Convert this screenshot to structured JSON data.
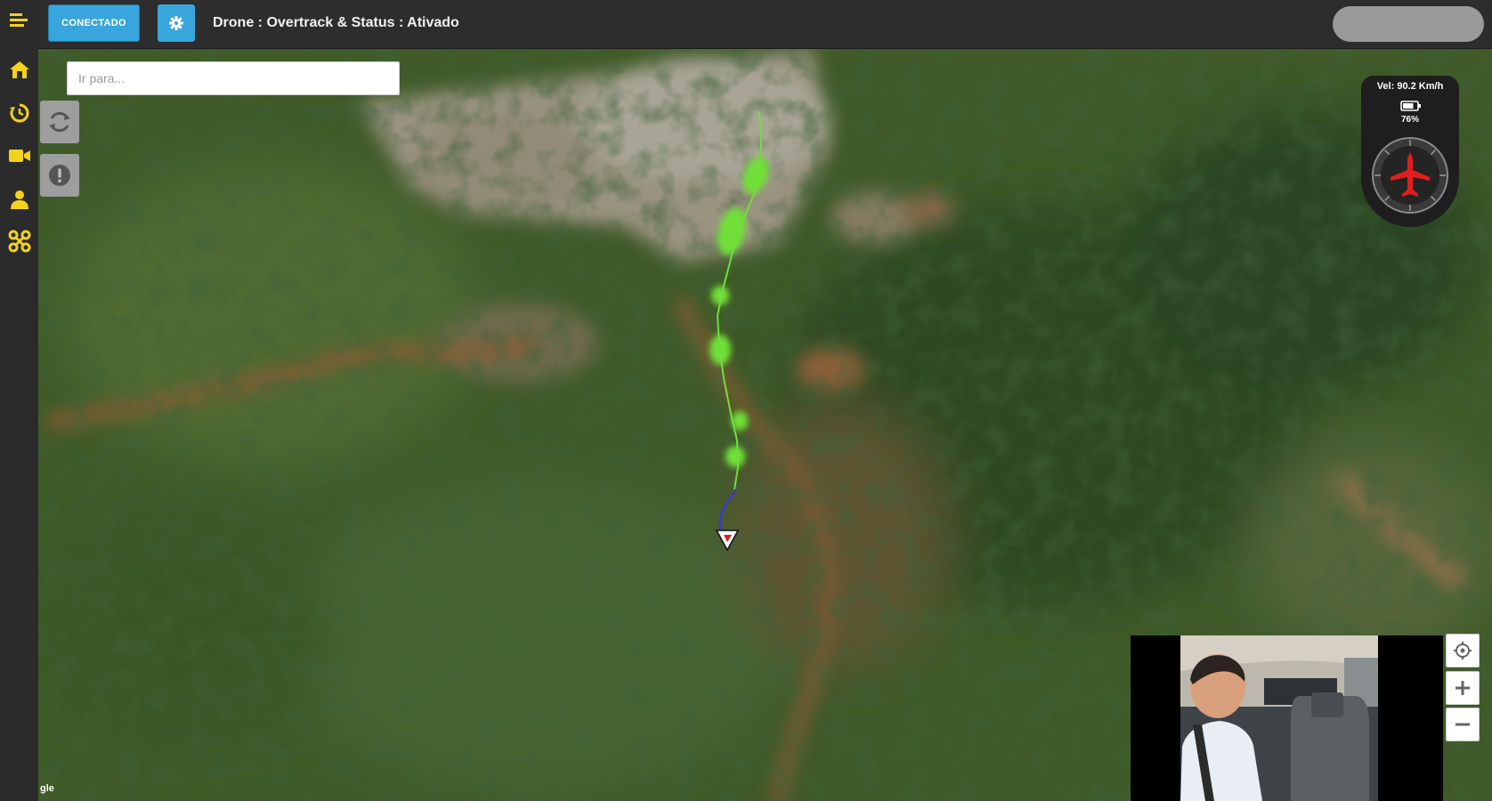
{
  "topbar": {
    "connect_label": "CONECTADO",
    "status": "Drone : Overtrack & Status : Ativado"
  },
  "sidebar": {
    "items": [
      {
        "icon": "menu-icon"
      },
      {
        "icon": "home-icon"
      },
      {
        "icon": "history-icon"
      },
      {
        "icon": "video-camera-icon"
      },
      {
        "icon": "user-icon"
      },
      {
        "icon": "drone-icon"
      }
    ]
  },
  "map": {
    "search_placeholder": "Ir para...",
    "attribution": "gle"
  },
  "hud": {
    "speed": "Vel: 90.2 Km/h",
    "battery": "76%",
    "battery_level": 0.76
  },
  "colors": {
    "accent": "#38a6dc",
    "icon_yellow": "#f2d21b",
    "track_green": "#6fe038",
    "track_blue": "#3a3ac8",
    "hud_red": "#e01e1e"
  }
}
